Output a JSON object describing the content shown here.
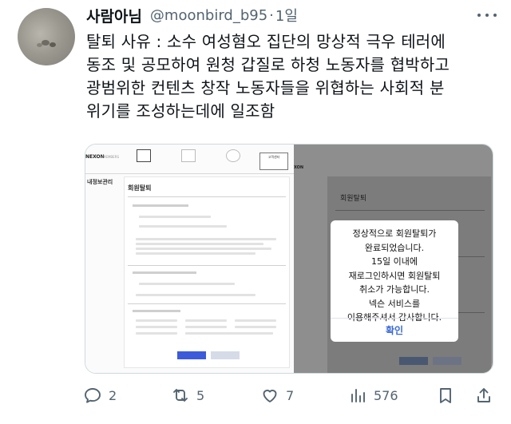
{
  "tweet": {
    "display_name": "사람아님",
    "handle": "@moonbird_b95",
    "separator": "·",
    "time": "1일",
    "text_lines": [
      "탈퇴 사유 : 소수 여성혐오 집단의 망상적 극우 테러에",
      "동조 및 공모하여 원청 갑질로 하청 노동자를 협박하고",
      "광범위한 컨텐츠 창작 노동자들을 위협하는 사회적 분",
      "위기를 조성하는데에 일조함"
    ]
  },
  "screenshot": {
    "left": {
      "logo": "NEXON",
      "logo_sub": "MEMBERS",
      "top_button": "고객센터",
      "sidebar_title": "내정보관리",
      "page_title": "회원탈퇴"
    },
    "right": {
      "logo": "XON",
      "page_title": "회원탈퇴"
    },
    "modal": {
      "message_lines": [
        "정상적으로 회원탈퇴가",
        "완료되었습니다.",
        "15일 이내에",
        "재로그인하시면 회원탈퇴",
        "취소가 가능합니다.",
        "넥슨 서비스를",
        "이용해주셔서 감사합니다."
      ],
      "confirm_label": "확인"
    }
  },
  "actions": {
    "replies": "2",
    "retweets": "5",
    "likes": "7",
    "views": "576"
  },
  "colors": {
    "text": "#0f1419",
    "secondary": "#536471",
    "modal_confirm": "#3b6ad6"
  },
  "icons": [
    "more-icon",
    "reply-icon",
    "retweet-icon",
    "like-icon",
    "views-icon",
    "bookmark-icon",
    "share-icon"
  ]
}
